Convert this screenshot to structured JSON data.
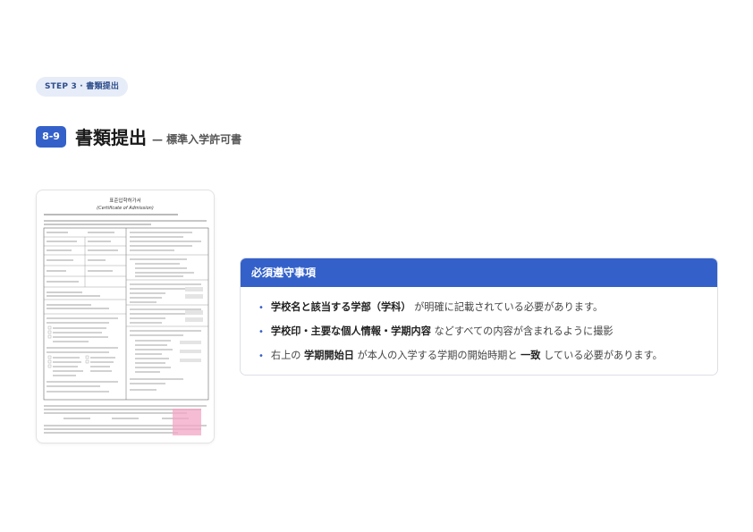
{
  "step_label": "STEP 3 · 書類提出",
  "section": {
    "number": "8-9",
    "title": "書類提出",
    "subtitle": "— 標準入学許可書"
  },
  "document": {
    "title_ko": "표준입학허가서",
    "title_en": "(Certificate of Admission)",
    "colors": {
      "seal": "#f3a6c4",
      "border": "#666666"
    }
  },
  "requirements": {
    "header": "必須遵守事項",
    "items": [
      {
        "bold1": "学校名と該当する学部（学科）",
        "text1": " が明確に記載されている必要があります。"
      },
      {
        "bold1": "学校印・主要な個人情報・学期内容",
        "text1": " などすべての内容が含まれるように撮影"
      },
      {
        "pre": "右上の ",
        "bold1": "学期開始日",
        "text1": " が本人の入学する学期の開始時期と ",
        "bold2": "一致",
        "text2": " している必要があります。"
      }
    ]
  },
  "colors": {
    "accent": "#3461c9",
    "pill_bg": "#e6ecf8"
  }
}
